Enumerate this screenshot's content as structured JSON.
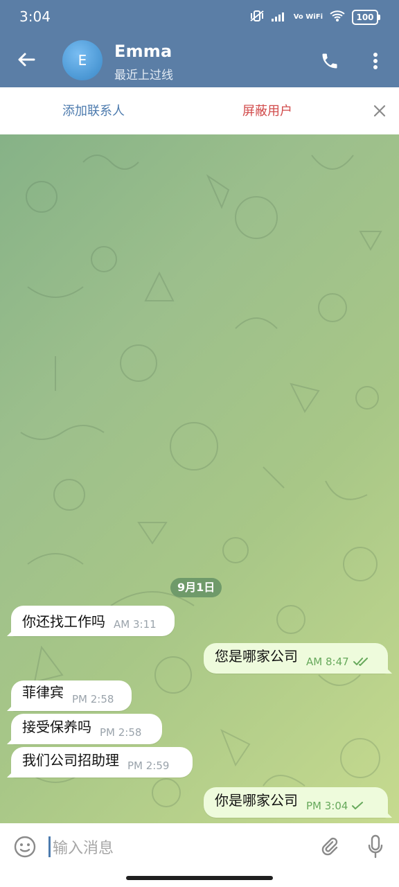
{
  "status_bar": {
    "time": "3:04",
    "network": "Vo WiFi",
    "battery": "100"
  },
  "header": {
    "avatar_letter": "E",
    "name": "Emma",
    "last_seen": "最近上过线"
  },
  "action_bar": {
    "add_contact": "添加联系人",
    "block_user": "屏蔽用户"
  },
  "chat": {
    "date": "9月1日",
    "messages": [
      {
        "dir": "in",
        "text": "你还找工作吗",
        "time": "AM 3:11"
      },
      {
        "dir": "out",
        "text": "您是哪家公司",
        "time": "AM 8:47",
        "status": "read"
      },
      {
        "dir": "in",
        "text": "菲律宾",
        "time": "PM 2:58"
      },
      {
        "dir": "in",
        "text": "接受保养吗",
        "time": "PM 2:58"
      },
      {
        "dir": "in",
        "text": "我们公司招助理",
        "time": "PM 2:59"
      },
      {
        "dir": "out",
        "text": "你是哪家公司",
        "time": "PM 3:04",
        "status": "sent"
      }
    ]
  },
  "composer": {
    "placeholder": "输入消息"
  },
  "colors": {
    "header_bg": "#5b7ea6",
    "accent_blue": "#4d7bae",
    "danger_red": "#d14a4a",
    "outgoing_bubble": "#eefbdc",
    "outgoing_meta": "#67a95c"
  }
}
